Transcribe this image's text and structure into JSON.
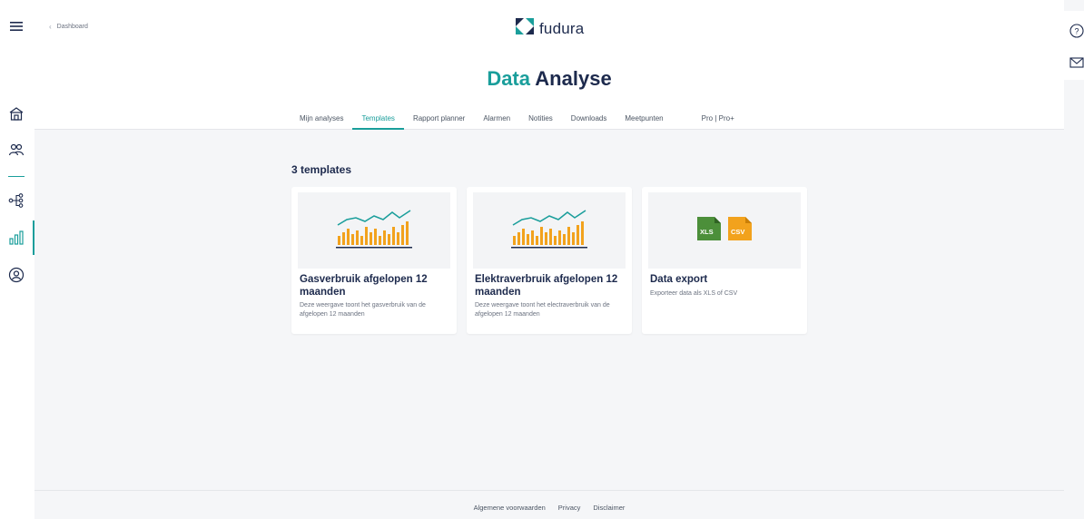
{
  "header": {
    "breadcrumb": "Dashboard",
    "logo_text": "fudura",
    "title_part1": "Data",
    "title_part2": "Analyse"
  },
  "tabs": [
    {
      "label": "Mijn analyses",
      "active": false
    },
    {
      "label": "Templates",
      "active": true
    },
    {
      "label": "Rapport planner",
      "active": false
    },
    {
      "label": "Alarmen",
      "active": false
    },
    {
      "label": "Notities",
      "active": false
    },
    {
      "label": "Downloads",
      "active": false
    },
    {
      "label": "Meetpunten",
      "active": false
    },
    {
      "label": "Pro | Pro+",
      "active": false
    }
  ],
  "main": {
    "count_label": "3 templates",
    "cards": [
      {
        "title": "Gasverbruik afgelopen 12 maanden",
        "description": "Deze weergave toont het gasverbruik van de afgelopen 12 maanden",
        "thumbnail": "bar-line-chart-icon"
      },
      {
        "title": "Elektraverbruik afgelopen 12 maanden",
        "description": "Deze weergave toont het electraverbruik van de afgelopen 12 maanden",
        "thumbnail": "bar-line-chart-icon"
      },
      {
        "title": "Data export",
        "description": "Exporteer data als XLS of CSV",
        "thumbnail_xls": "XLS",
        "thumbnail_csv": "CSV"
      }
    ]
  },
  "footer": {
    "links": [
      "Algemene voorwaarden",
      "Privacy",
      "Disclaimer"
    ]
  },
  "colors": {
    "accent": "#1a9e9b",
    "navy": "#1d2a4d",
    "bar_orange": "#f2a21d",
    "xls_green": "#4c8f3a",
    "csv_orange": "#f2a21d"
  }
}
